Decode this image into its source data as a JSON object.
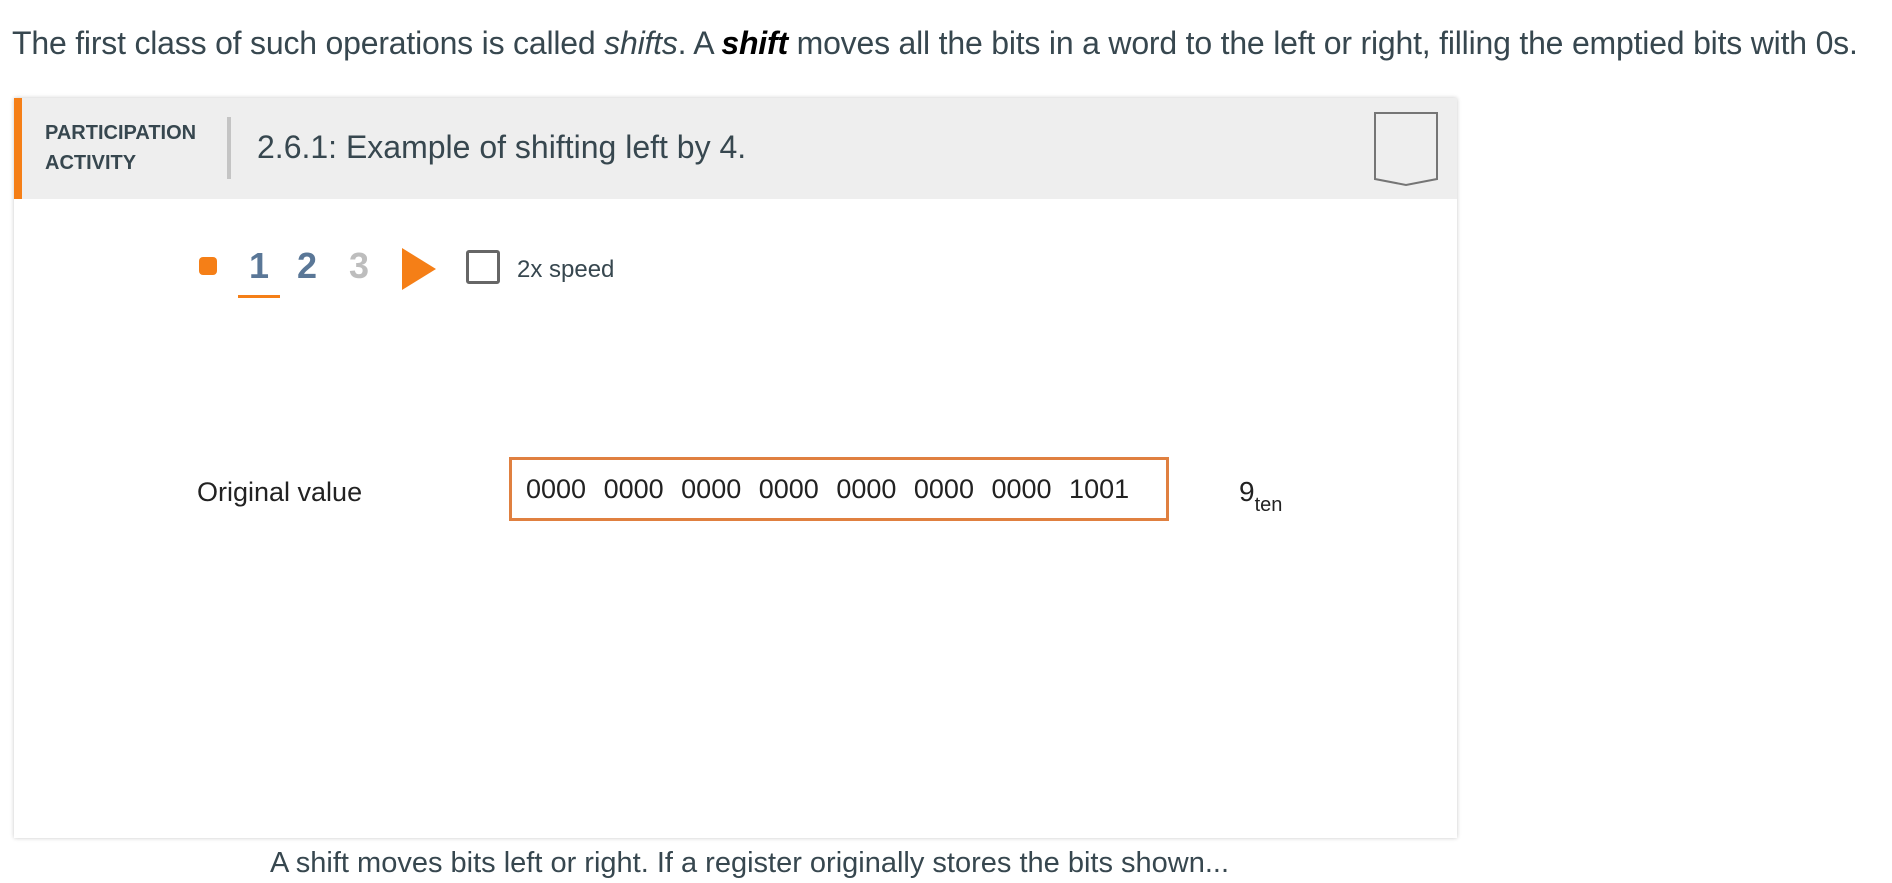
{
  "intro": {
    "part1": "The first class of such operations is called ",
    "term_italic": "shifts",
    "part2": ". A ",
    "term_bold": "shift",
    "part3": " moves all the bits in a word to the left or right, filling the emptied bits with 0s."
  },
  "activity": {
    "type_line1": "PARTICIPATION",
    "type_line2": "ACTIVITY",
    "title": "2.6.1: Example of shifting left by 4.",
    "bookmark_icon": "bookmark-icon",
    "accent_color": "#f57f17"
  },
  "controls": {
    "steps": [
      "1",
      "2",
      "3"
    ],
    "current_step": 1,
    "speed_label": "2x speed",
    "speed_checked": false
  },
  "animation": {
    "original_label": "Original value",
    "nibbles": [
      "0000",
      "0000",
      "0000",
      "0000",
      "0000",
      "0000",
      "0000",
      "1001"
    ],
    "decimal_value": "9",
    "decimal_base": "ten",
    "caption": "A shift moves bits left or right. If a register originally stores the bits shown..."
  }
}
